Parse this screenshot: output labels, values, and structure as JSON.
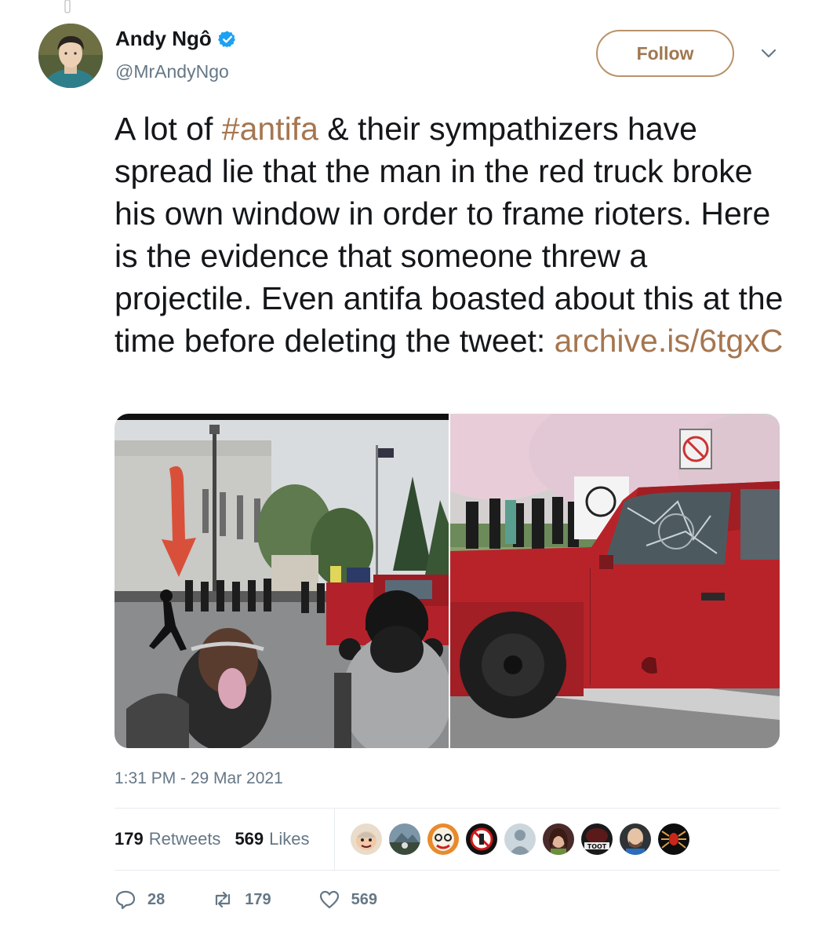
{
  "author": {
    "name": "Andy Ngô",
    "handle": "@MrAndyNgo",
    "verified": true,
    "follow_label": "Follow"
  },
  "tweet": {
    "text_parts": [
      "A lot of ",
      "#antifa",
      " & their sympathizers have spread lie that the man in the red truck broke his own window in order to frame rioters. Here is the evidence that someone threw a projectile. Even antifa boasted about this at the time before deleting the tweet: ",
      "archive.is/6tgxC"
    ],
    "timestamp": "1:31 PM - 29 Mar 2021"
  },
  "stats": {
    "retweets_count": "179",
    "retweets_label": "Retweets",
    "likes_count": "569",
    "likes_label": "Likes"
  },
  "actions": {
    "replies": "28",
    "retweets": "179",
    "likes": "569"
  },
  "liker_avatars": [
    "avatar-cartoon",
    "avatar-landscape",
    "avatar-clown",
    "avatar-no-symbol",
    "avatar-default",
    "avatar-woman",
    "avatar-toot",
    "avatar-man",
    "avatar-spider"
  ],
  "colors": {
    "link": "#a6764f",
    "verified": "#1da1f2",
    "muted": "#657786",
    "follow_border": "#b8926a"
  }
}
